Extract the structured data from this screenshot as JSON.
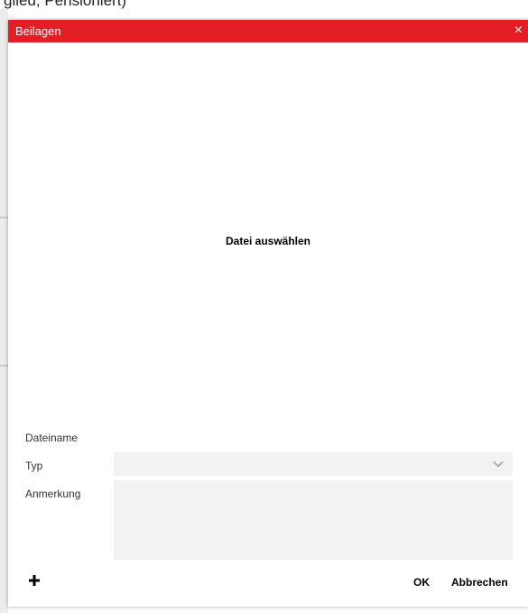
{
  "background": {
    "partial_text": "glied, Pensioniert)"
  },
  "dialog": {
    "title": "Beilagen",
    "close_label": "×",
    "header_color": "#e31e24",
    "file_select_label": "Datei auswählen",
    "form": {
      "filename_label": "Dateiname",
      "type_label": "Typ",
      "type_value": "",
      "note_label": "Anmerkung",
      "note_value": ""
    },
    "footer": {
      "add_icon": "plus-icon",
      "ok_label": "OK",
      "cancel_label": "Abbrechen"
    }
  }
}
